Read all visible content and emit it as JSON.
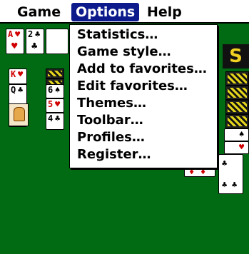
{
  "menubar": {
    "game": "Game",
    "options": "Options",
    "help": "Help"
  },
  "options_menu": {
    "items": [
      "Statistics…",
      "Game style…",
      "Add to favorites…",
      "Edit favorites…",
      "Themes…",
      "Toolbar…",
      "Profiles…",
      "Register…"
    ]
  },
  "cards": {
    "ace_hearts": {
      "rank": "A",
      "suit": "♥"
    },
    "two_clubs": {
      "rank": "2",
      "suit": "♣"
    },
    "king_hearts": {
      "rank": "K",
      "suit": "♥"
    },
    "queen_clubs": {
      "rank": "Q",
      "suit": "♣"
    },
    "six_spades": {
      "rank": "6",
      "suit": "♠"
    },
    "five_hearts": {
      "rank": "5",
      "suit": "♥"
    },
    "four_clubs": {
      "rank": "4",
      "suit": "♣"
    }
  },
  "colors": {
    "felt": "#006b12",
    "menu_highlight": "#0d1a8c"
  }
}
